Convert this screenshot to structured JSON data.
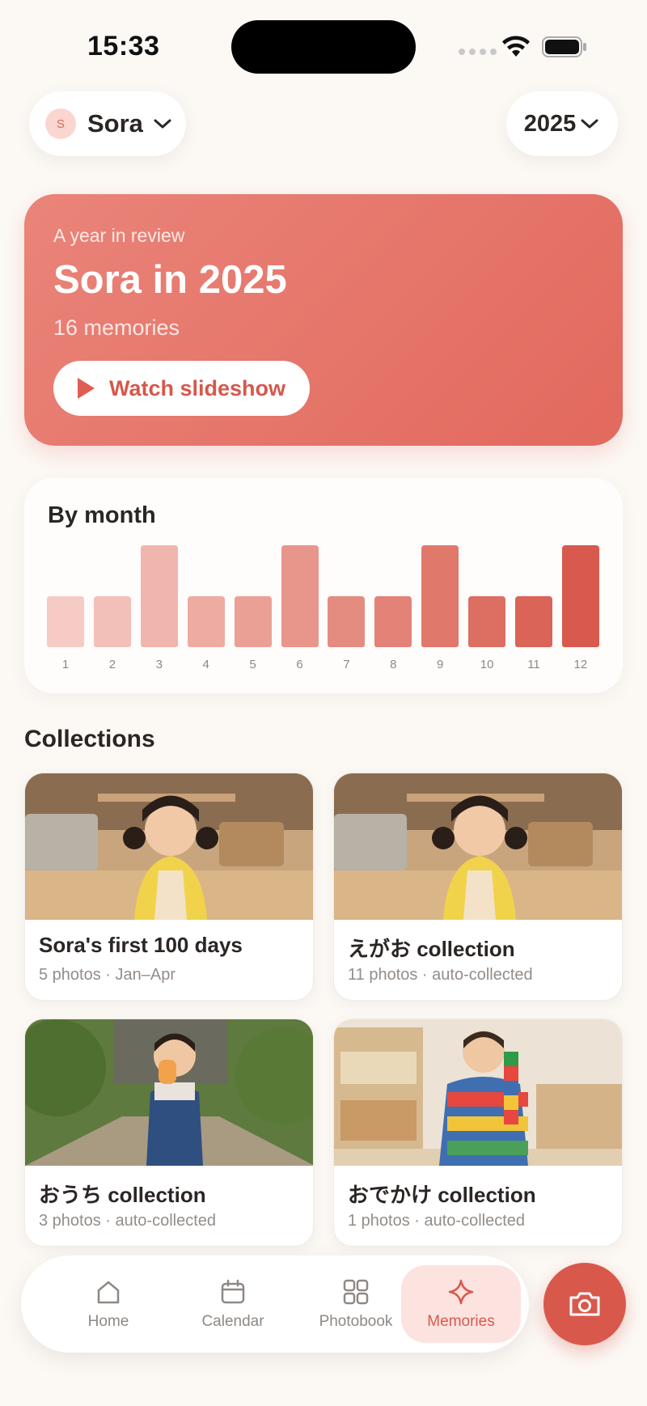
{
  "status_bar": {
    "time": "15:33"
  },
  "header": {
    "child_initial": "S",
    "child_name": "Sora",
    "year": "2025"
  },
  "hero": {
    "eyebrow": "A year in review",
    "title": "Sora in 2025",
    "count": "16 memories",
    "button_label": "Watch slideshow"
  },
  "chart_data": {
    "type": "bar",
    "title": "By month",
    "categories": [
      "1",
      "2",
      "3",
      "4",
      "5",
      "6",
      "7",
      "8",
      "9",
      "10",
      "11",
      "12"
    ],
    "values": [
      1,
      1,
      2,
      1,
      1,
      2,
      1,
      1,
      2,
      1,
      1,
      2
    ],
    "ylim": [
      0,
      2
    ],
    "grid": false,
    "colors": [
      "#f6cbc5",
      "#f3c0b9",
      "#f0b5ad",
      "#eeaba2",
      "#eba096",
      "#e8968b",
      "#e58c81",
      "#e38276",
      "#e0786c",
      "#dd6e62",
      "#da6458",
      "#d85a4e"
    ]
  },
  "collections": {
    "heading": "Collections",
    "items": [
      {
        "title": "Sora's first 100 days",
        "subtitle": "5 photos · Jan–Apr",
        "photo": "girl-indoors"
      },
      {
        "title": "えがお collection",
        "subtitle": "11 photos · auto-collected",
        "photo": "girl-indoors"
      },
      {
        "title": "おうち collection",
        "subtitle": "3 photos · auto-collected",
        "photo": "girl-garden"
      },
      {
        "title": "おでかけ collection",
        "subtitle": "1 photos · auto-collected",
        "photo": "boy-blocks"
      }
    ]
  },
  "tabs": [
    {
      "label": "Home",
      "icon": "home-icon",
      "active": false
    },
    {
      "label": "Calendar",
      "icon": "calendar-icon",
      "active": false
    },
    {
      "label": "Photobook",
      "icon": "grid-icon",
      "active": false
    },
    {
      "label": "Memories",
      "icon": "sparkle-icon",
      "active": true
    }
  ],
  "colors": {
    "accent": "#d9584c",
    "background": "#fcf9f5"
  }
}
